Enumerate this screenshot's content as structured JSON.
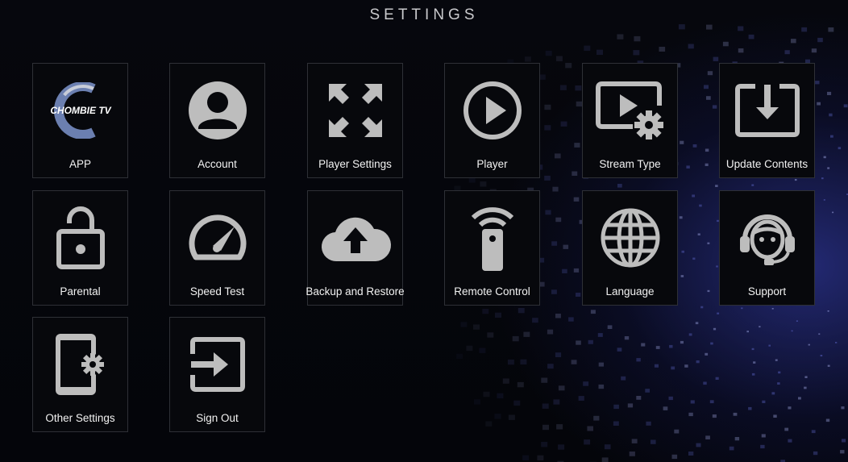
{
  "header": {
    "title": "SETTINGS"
  },
  "logo": {
    "text": "CHOMBIE TV"
  },
  "tiles": [
    {
      "label": "APP",
      "icon": "chombie-tv-logo"
    },
    {
      "label": "Account",
      "icon": "account-icon"
    },
    {
      "label": "Player Settings",
      "icon": "fullscreen-icon"
    },
    {
      "label": "Player",
      "icon": "play-icon"
    },
    {
      "label": "Stream Type",
      "icon": "stream-settings-icon"
    },
    {
      "label": "Update Contents",
      "icon": "download-icon"
    },
    {
      "label": "Parental",
      "icon": "unlock-icon"
    },
    {
      "label": "Speed Test",
      "icon": "speedometer-icon"
    },
    {
      "label": "Backup and Restore",
      "icon": "cloud-upload-icon"
    },
    {
      "label": "Remote Control",
      "icon": "remote-icon"
    },
    {
      "label": "Language",
      "icon": "globe-icon"
    },
    {
      "label": "Support",
      "icon": "support-agent-icon"
    },
    {
      "label": "Other Settings",
      "icon": "phone-settings-icon"
    },
    {
      "label": "Sign Out",
      "icon": "sign-out-icon"
    }
  ],
  "colors": {
    "icon": "#bdbdbd",
    "tile_bg": "#07080c",
    "tile_border": "#2e3036",
    "text": "#f2f2f2"
  }
}
